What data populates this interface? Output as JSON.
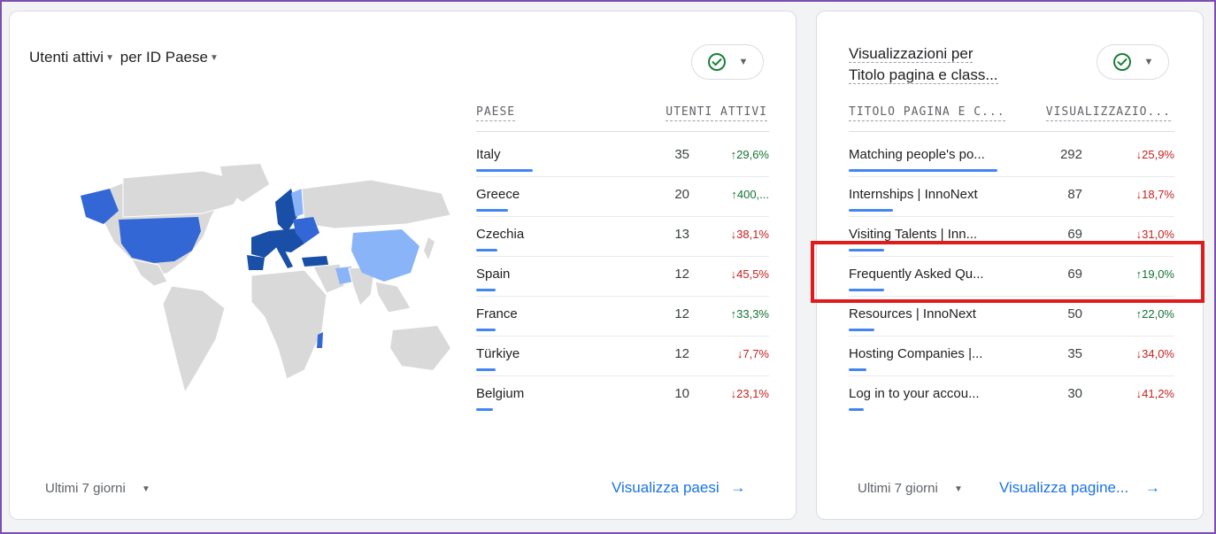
{
  "colors": {
    "accent": "#1a73e8",
    "bar": "#4285f4",
    "up": "#137333",
    "down": "#c5221f",
    "highlight": "#e01b1b",
    "map_dark": "#1a4fa8",
    "map_mid": "#3367d6",
    "map_light": "#8ab4f8",
    "map_gray": "#d9d9d9"
  },
  "countries_card": {
    "title_metric": "Utenti attivi",
    "title_dimension": "per ID Paese",
    "compare_icon": "check-circle-icon",
    "headers": {
      "dimension": "PAESE",
      "metric": "UTENTI ATTIVI"
    },
    "rows": [
      {
        "name": "Italy",
        "value": "35",
        "change": "29,6%",
        "direction": "up",
        "share": 1.0
      },
      {
        "name": "Greece",
        "value": "20",
        "change": "400,...",
        "direction": "up",
        "share": 0.57
      },
      {
        "name": "Czechia",
        "value": "13",
        "change": "38,1%",
        "direction": "down",
        "share": 0.37
      },
      {
        "name": "Spain",
        "value": "12",
        "change": "45,5%",
        "direction": "down",
        "share": 0.34
      },
      {
        "name": "France",
        "value": "12",
        "change": "33,3%",
        "direction": "up",
        "share": 0.34
      },
      {
        "name": "Türkiye",
        "value": "12",
        "change": "7,7%",
        "direction": "down",
        "share": 0.34
      },
      {
        "name": "Belgium",
        "value": "10",
        "change": "23,1%",
        "direction": "down",
        "share": 0.29
      }
    ],
    "date_range": "Ultimi 7 giorni",
    "link": "Visualizza paesi"
  },
  "pages_card": {
    "title_line1": "Visualizzazioni per",
    "title_line2": "Titolo pagina e class...",
    "compare_icon": "check-circle-icon",
    "headers": {
      "dimension": "TITOLO PAGINA E C...",
      "metric": "VISUALIZZAZIO..."
    },
    "rows": [
      {
        "name": "Matching people's po...",
        "value": "292",
        "change": "25,9%",
        "direction": "down",
        "share": 1.0
      },
      {
        "name": "Internships | InnoNext",
        "value": "87",
        "change": "18,7%",
        "direction": "down",
        "share": 0.3
      },
      {
        "name": "Visiting Talents | Inn...",
        "value": "69",
        "change": "31,0%",
        "direction": "down",
        "share": 0.24
      },
      {
        "name": "Frequently Asked Qu...",
        "value": "69",
        "change": "19,0%",
        "direction": "up",
        "share": 0.24
      },
      {
        "name": "Resources | InnoNext",
        "value": "50",
        "change": "22,0%",
        "direction": "up",
        "share": 0.17
      },
      {
        "name": "Hosting Companies |...",
        "value": "35",
        "change": "34,0%",
        "direction": "down",
        "share": 0.12
      },
      {
        "name": "Log in to your accou...",
        "value": "30",
        "change": "41,2%",
        "direction": "down",
        "share": 0.1
      }
    ],
    "date_range": "Ultimi 7 giorni",
    "link": "Visualizza pagine..."
  },
  "highlighted_row": "Frequently Asked Qu..."
}
